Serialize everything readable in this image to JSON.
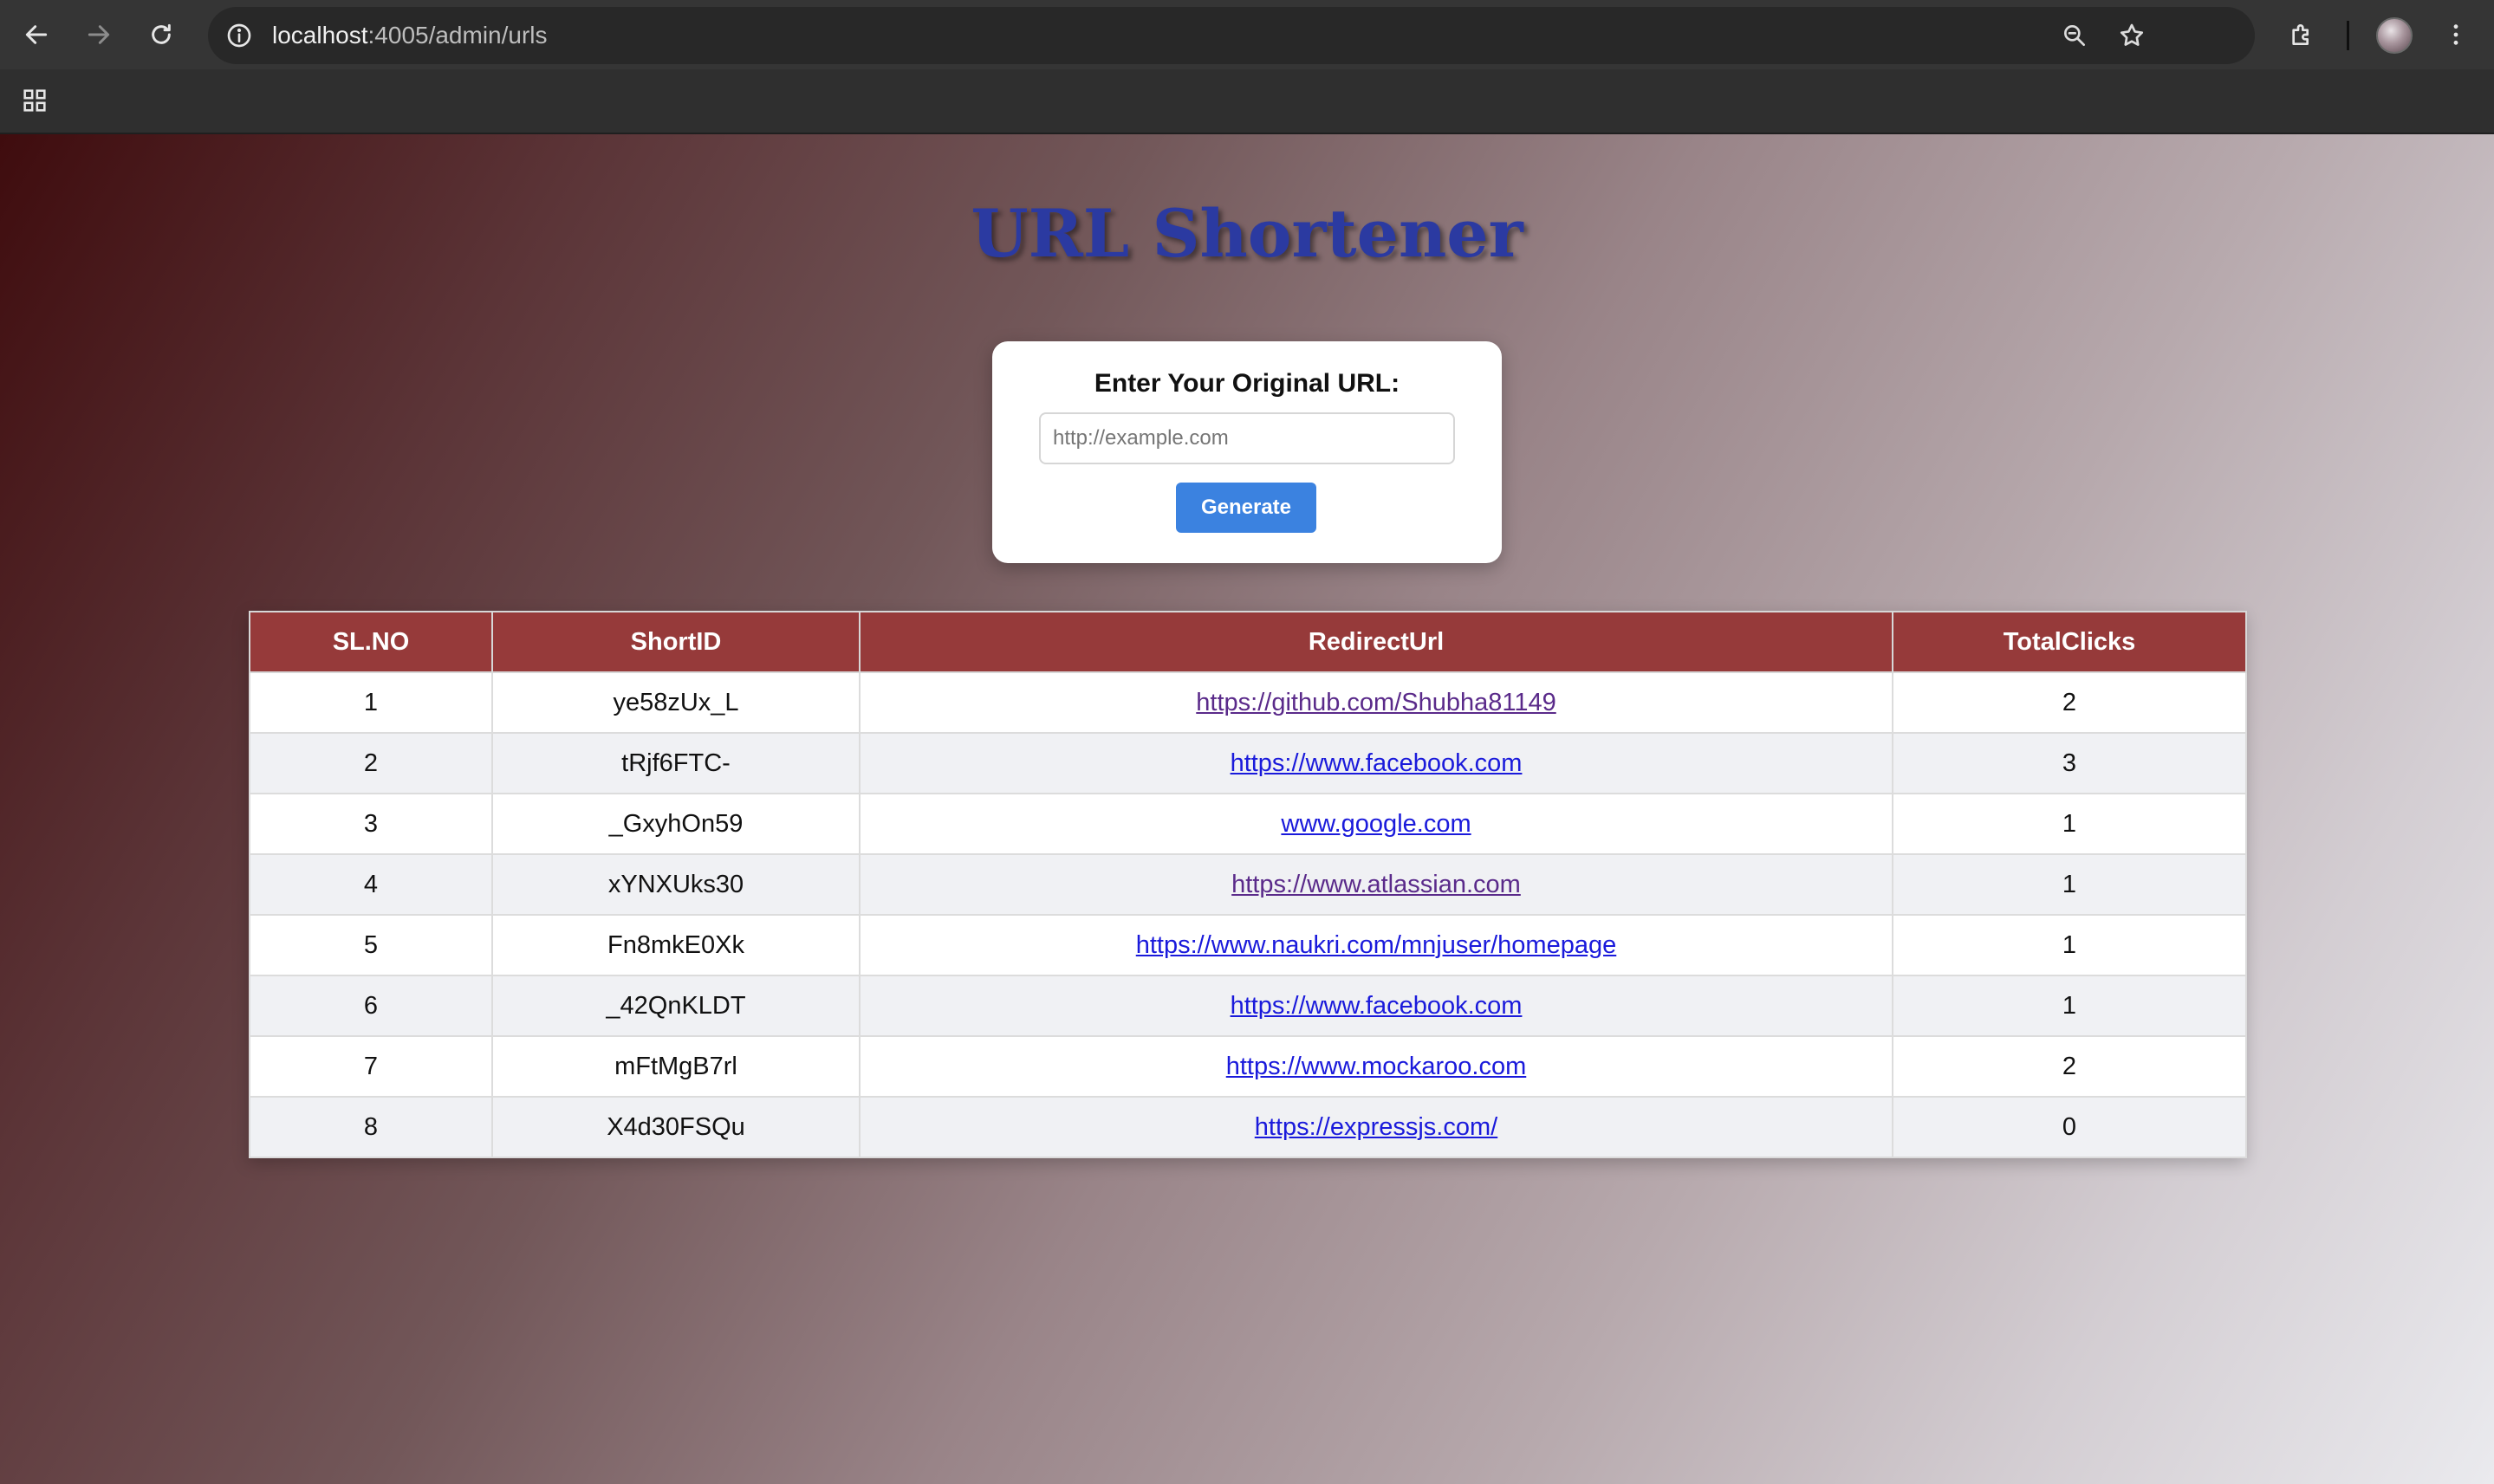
{
  "browser": {
    "url_host": "localhost",
    "url_path": ":4005/admin/urls"
  },
  "app": {
    "title": "URL Shortener",
    "form": {
      "label": "Enter Your Original URL:",
      "input_placeholder": "http://example.com",
      "input_value": "",
      "button_label": "Generate"
    }
  },
  "table": {
    "columns": [
      "SL.NO",
      "ShortID",
      "RedirectUrl",
      "TotalClicks"
    ],
    "rows": [
      {
        "sl": "1",
        "short_id": "ye58zUx_L",
        "redirect": "https://github.com/Shubha81149",
        "clicks": "2",
        "visited": true
      },
      {
        "sl": "2",
        "short_id": "tRjf6FTC-",
        "redirect": "https://www.facebook.com",
        "clicks": "3",
        "visited": false
      },
      {
        "sl": "3",
        "short_id": "_GxyhOn59",
        "redirect": "www.google.com",
        "clicks": "1",
        "visited": false
      },
      {
        "sl": "4",
        "short_id": "xYNXUks30",
        "redirect": "https://www.atlassian.com",
        "clicks": "1",
        "visited": true
      },
      {
        "sl": "5",
        "short_id": "Fn8mkE0Xk",
        "redirect": "https://www.naukri.com/mnjuser/homepage",
        "clicks": "1",
        "visited": false
      },
      {
        "sl": "6",
        "short_id": "_42QnKLDT",
        "redirect": "https://www.facebook.com",
        "clicks": "1",
        "visited": false
      },
      {
        "sl": "7",
        "short_id": "mFtMgB7rl",
        "redirect": "https://www.mockaroo.com",
        "clicks": "2",
        "visited": false
      },
      {
        "sl": "8",
        "short_id": "X4d30FSQu",
        "redirect": "https://expressjs.com/",
        "clicks": "0",
        "visited": false
      }
    ]
  },
  "colors": {
    "header_bg": "#963a3a",
    "title": "#2b3aa1",
    "button": "#3b82e0",
    "link": "#1a1adb",
    "link_visited": "#5a2a8a"
  },
  "icons": {
    "back": "back-arrow-icon",
    "forward": "forward-arrow-icon",
    "reload": "reload-icon",
    "info": "info-icon",
    "zoom": "zoom-icon",
    "star": "bookmark-star-icon",
    "extensions": "extensions-icon",
    "menu": "kebab-menu-icon",
    "apps": "apps-grid-icon"
  }
}
